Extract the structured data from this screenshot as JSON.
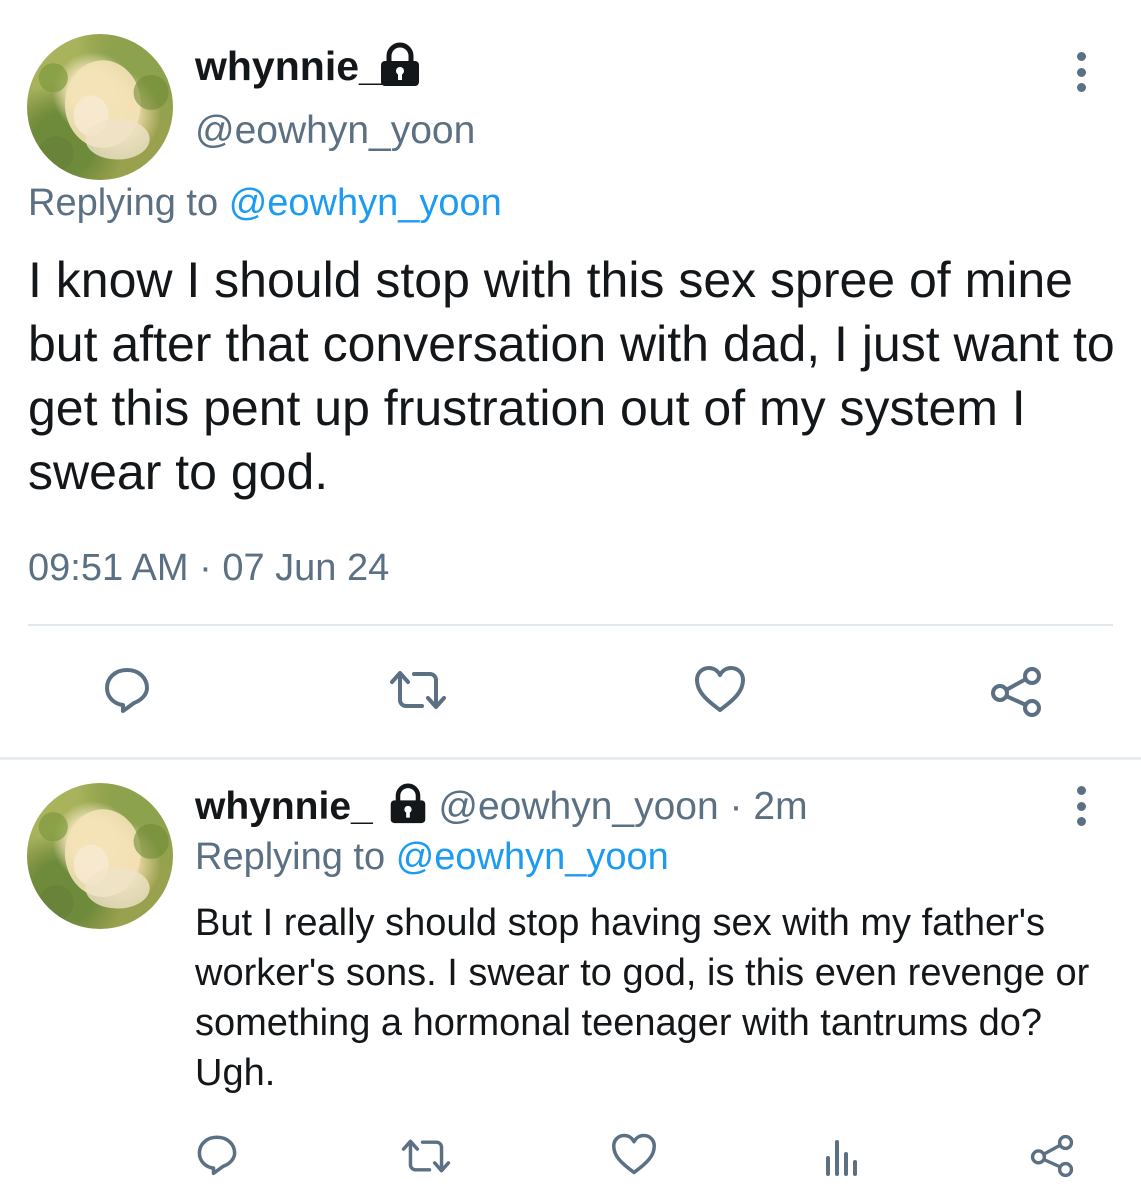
{
  "main_tweet": {
    "display_name": "whynnie_",
    "handle": "@eowhyn_yoon",
    "replying_prefix": "Replying to",
    "replying_handle": "@eowhyn_yoon",
    "text": "I know I should stop with this sex spree of mine but after that conversation with dad, I just want to  get this pent up frustration out of my system I swear to god.",
    "time": "09:51 AM",
    "separator": "·",
    "date": "07 Jun 24",
    "icons": [
      "lock-icon",
      "more-vertical-icon",
      "reply-icon",
      "retweet-icon",
      "like-icon",
      "share-icon"
    ]
  },
  "reply_tweet": {
    "display_name": "whynnie_",
    "handle": "@eowhyn_yoon",
    "separator": "·",
    "age": "2m",
    "replying_prefix": "Replying to",
    "replying_handle": "@eowhyn_yoon",
    "text": "But I really should stop having sex with my father's worker's sons. I swear to god, is this even revenge or something a hormonal teenager with tantrums do? Ugh.",
    "icons": [
      "lock-icon",
      "more-vertical-icon",
      "reply-icon",
      "retweet-icon",
      "like-icon",
      "analytics-icon",
      "share-icon"
    ]
  },
  "colors": {
    "text": "#14171a",
    "muted": "#5b7083",
    "link": "#1d9bf0",
    "divider": "#e1e8ed",
    "background": "#ffffff"
  }
}
